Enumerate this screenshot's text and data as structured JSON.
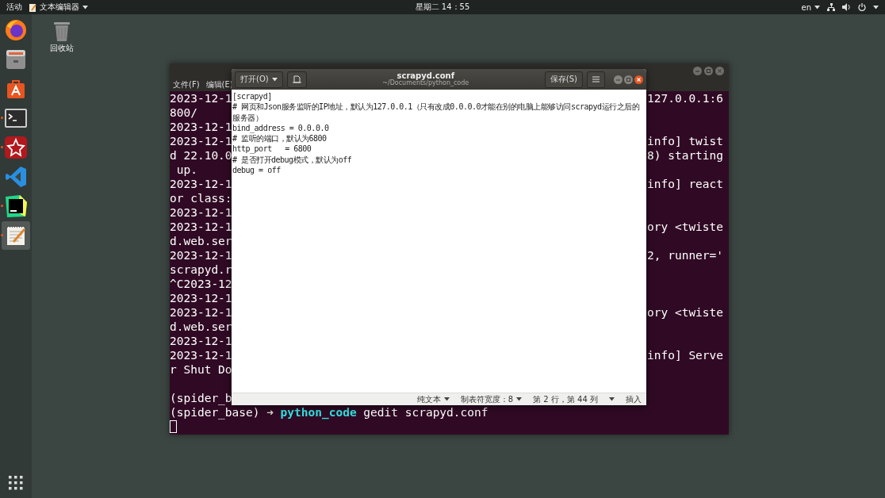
{
  "top_bar": {
    "activities": "活动",
    "app_menu": "文本编辑器",
    "clock": "星期二 14：55",
    "language": "en"
  },
  "dock": {
    "items": [
      {
        "kind": "browser",
        "running": false,
        "selected": false
      },
      {
        "kind": "files",
        "running": false,
        "selected": false
      },
      {
        "kind": "software",
        "running": false,
        "selected": false
      },
      {
        "kind": "terminal",
        "running": true,
        "selected": false
      },
      {
        "kind": "star",
        "running": true,
        "selected": false
      },
      {
        "kind": "code",
        "running": false,
        "selected": false
      },
      {
        "kind": "ide",
        "running": true,
        "selected": false
      },
      {
        "kind": "notepad",
        "running": true,
        "selected": true
      }
    ]
  },
  "desktop_icons": [
    {
      "label": "回收站"
    }
  ],
  "terminal": {
    "menu": [
      "文件(F)",
      "编辑(E)"
    ],
    "lines": [
      {
        "left": "2023-12-1",
        "right": "127.0.0.1:6"
      },
      {
        "left": "800/"
      },
      {
        "left": "2023-12-1"
      },
      {
        "left": "2023-12-1",
        "right": "info] twist"
      },
      {
        "left": "d 22.10.0",
        "right": "8) starting"
      },
      {
        "left": " up."
      },
      {
        "left": "2023-12-1",
        "right": "info] react"
      },
      {
        "left": "or class:"
      },
      {
        "left": "2023-12-1"
      },
      {
        "left": "2023-12-1",
        "right": "ory <twiste"
      },
      {
        "left": "d.web.ser"
      },
      {
        "left": "2023-12-1",
        "right": "2, runner='"
      },
      {
        "left": "scrapyd.r"
      },
      {
        "left": "^C2023-12"
      },
      {
        "left": "2023-12-1"
      },
      {
        "left": "2023-12-1",
        "right": "ory <twiste"
      },
      {
        "left": "d.web.ser"
      },
      {
        "left": "2023-12-1"
      },
      {
        "left": "2023-12-1",
        "right": "info] Serve"
      },
      {
        "left": "r Shut Do"
      },
      {
        "left": "(spider_b",
        "space_before": true
      }
    ],
    "prompt": [
      {
        "kind": "env",
        "text": "(spider_base)"
      },
      {
        "kind": "arrow",
        "text": "➜"
      },
      {
        "kind": "dir",
        "text": "python_code"
      },
      {
        "kind": "command",
        "text": "gedit scrapyd.conf"
      }
    ]
  },
  "editor": {
    "open_button": "打开(O)",
    "title": "scrapyd.conf",
    "subtitle": "~/Documents/python_code",
    "save_button": "保存(S)",
    "lines": [
      "[scrapyd]",
      "# 网页和Json服务监听的IP地址，默认为127.0.0.1（只有改成0.0.0.0才能在别的电脑上能够访问scrapyd运行之后的服务器）",
      "bind_address = 0.0.0.0",
      "# 监听的端口，默认为6800",
      "http_port   = 6800",
      "# 是否打开debug模式，默认为off",
      "debug = off"
    ],
    "status": {
      "language": "纯文本",
      "tab_width": "制表符宽度：8",
      "position": "第 2 行，第 44 列",
      "mode": "插入"
    }
  }
}
